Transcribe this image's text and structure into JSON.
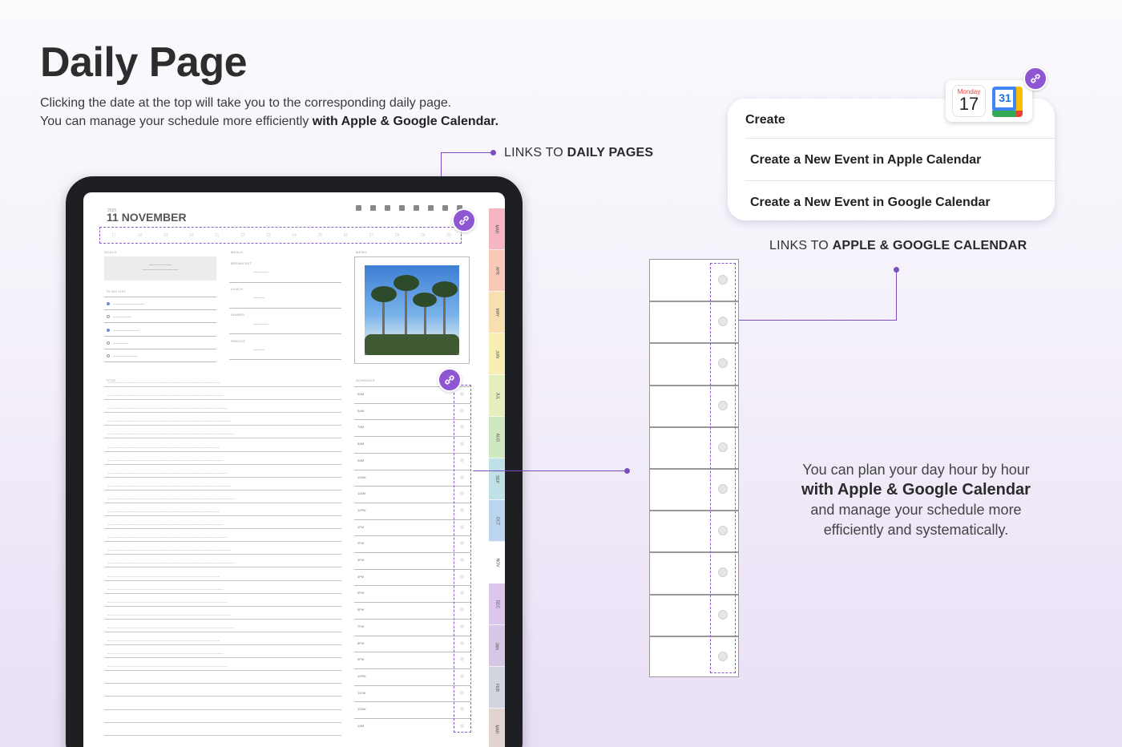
{
  "hero": {
    "title": "Daily Page",
    "subtitle_line1": "Clicking the date at the top will take you to the corresponding daily page.",
    "subtitle_line2_prefix": "You can manage your schedule more efficiently ",
    "subtitle_line2_bold": "with Apple & Google Calendar."
  },
  "callouts": {
    "daily_prefix": "LINKS TO ",
    "daily_bold": "DAILY PAGES",
    "calendar_prefix": "LINKS TO ",
    "calendar_bold": "APPLE & GOOGLE CALENDAR"
  },
  "planner": {
    "year": "2025",
    "date_title": "11 NOVEMBER",
    "week_days": [
      "17",
      "18",
      "19",
      "20",
      "21",
      "22",
      "23",
      "24",
      "25",
      "26",
      "27",
      "28",
      "29",
      "30"
    ],
    "labels": {
      "goals": "GOALS",
      "meals": "MEALS",
      "memo": "MEMO",
      "todo": "TO DO LIST",
      "title": "TITLE",
      "schedule": "SCHEDULE"
    },
    "meals": [
      "BREAKFAST",
      "LUNCH",
      "DINNER",
      "SNACKS"
    ],
    "schedule_times": [
      "5AM",
      "6AM",
      "7AM",
      "8AM",
      "9AM",
      "10AM",
      "11AM",
      "12PM",
      "1PM",
      "2PM",
      "3PM",
      "4PM",
      "5PM",
      "6PM",
      "7PM",
      "8PM",
      "9PM",
      "10PM",
      "11PM",
      "12AM",
      "1AM"
    ],
    "month_tabs": [
      {
        "label": "MAR",
        "color": "#f5b6bf"
      },
      {
        "label": "APR",
        "color": "#f7c9b6"
      },
      {
        "label": "MAY",
        "color": "#f7dfb2"
      },
      {
        "label": "JUN",
        "color": "#f8efb4"
      },
      {
        "label": "JUL",
        "color": "#e4efbd"
      },
      {
        "label": "AUG",
        "color": "#cfe8c2"
      },
      {
        "label": "SEP",
        "color": "#bfe0e6"
      },
      {
        "label": "OCT",
        "color": "#bcd5ef"
      },
      {
        "label": "NOV",
        "color": "#ffffff"
      },
      {
        "label": "DEC",
        "color": "#dcc6ec"
      },
      {
        "label": "JAN",
        "color": "#d6c8e4"
      },
      {
        "label": "FEB",
        "color": "#d2d4e0"
      },
      {
        "label": "MAR",
        "color": "#e2d4cf"
      }
    ]
  },
  "create_menu": {
    "title": "Create",
    "items": [
      "Create a New Event in Apple Calendar",
      "Create a New Event in Google Calendar"
    ]
  },
  "cal_icons": {
    "apple_weekday": "Monday",
    "apple_day": "17",
    "google_day": "31"
  },
  "plan": {
    "line1": "You can plan your day hour by hour",
    "bold": "with Apple & Google Calendar",
    "line3": "and manage your schedule more",
    "line4": "efficiently and systematically."
  },
  "colors": {
    "accent": "#8e56d3",
    "line": "#7a4fc2"
  }
}
